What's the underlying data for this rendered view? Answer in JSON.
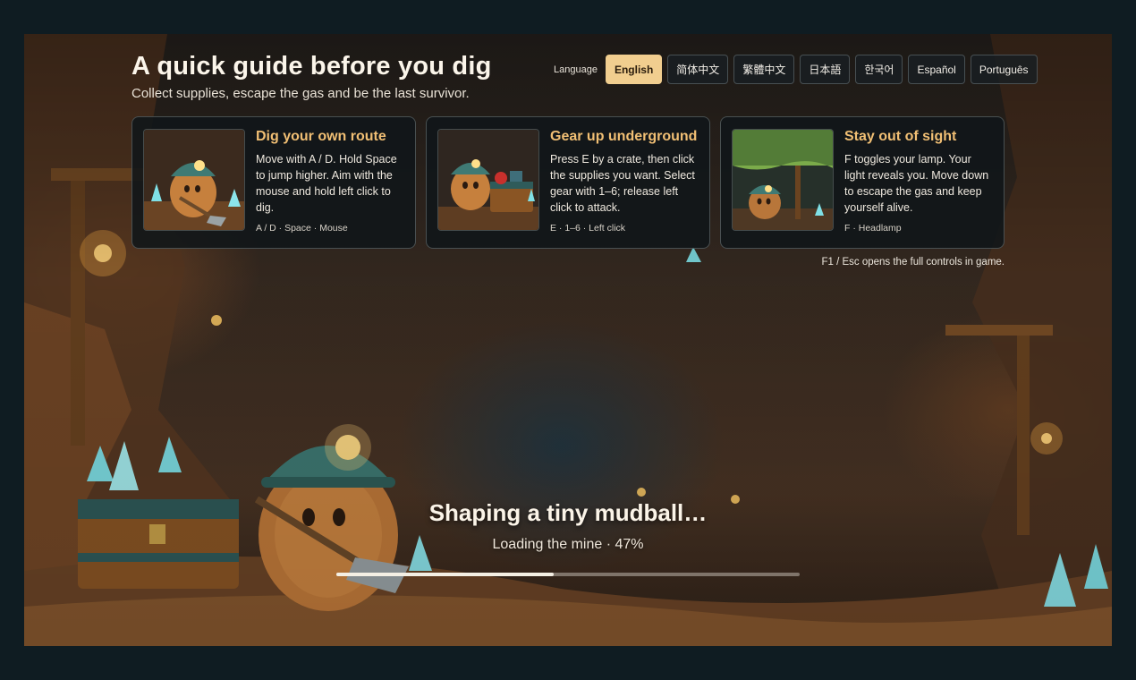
{
  "header": {
    "title": "A quick guide before you dig",
    "subtitle": "Collect supplies, escape the gas and be the last survivor."
  },
  "language": {
    "label": "Language",
    "options": [
      "English",
      "简体中文",
      "繁體中文",
      "日本語",
      "한국어",
      "Español",
      "Português"
    ],
    "selected": "English"
  },
  "cards": [
    {
      "title": "Dig your own route",
      "body": "Move with A / D. Hold Space to jump higher. Aim with the mouse and hold left click to dig.",
      "keys": "A / D · Space · Mouse",
      "image": "mudball-digging-with-shovel"
    },
    {
      "title": "Gear up underground",
      "body": "Press E by a crate, then click the supplies you want. Select gear with 1–6; release left click to attack.",
      "keys": "E · 1–6 · Left click",
      "image": "mudball-opening-supply-crate"
    },
    {
      "title": "Stay out of sight",
      "body": "F toggles your lamp. Your light reveals you. Move down to escape the gas and keep yourself alive.",
      "keys": "F · Headlamp",
      "image": "mudball-hiding-from-gas"
    }
  ],
  "hint": "F1 / Esc opens the full controls in game.",
  "loading": {
    "title": "Shaping a tiny mudball…",
    "status": "Loading the mine · 47%",
    "progress": 0.47
  },
  "colors": {
    "accent": "#f1bf74",
    "active_button": "#f1ce8f",
    "card_bg": "#101619",
    "page_bg": "#0f1c22"
  }
}
